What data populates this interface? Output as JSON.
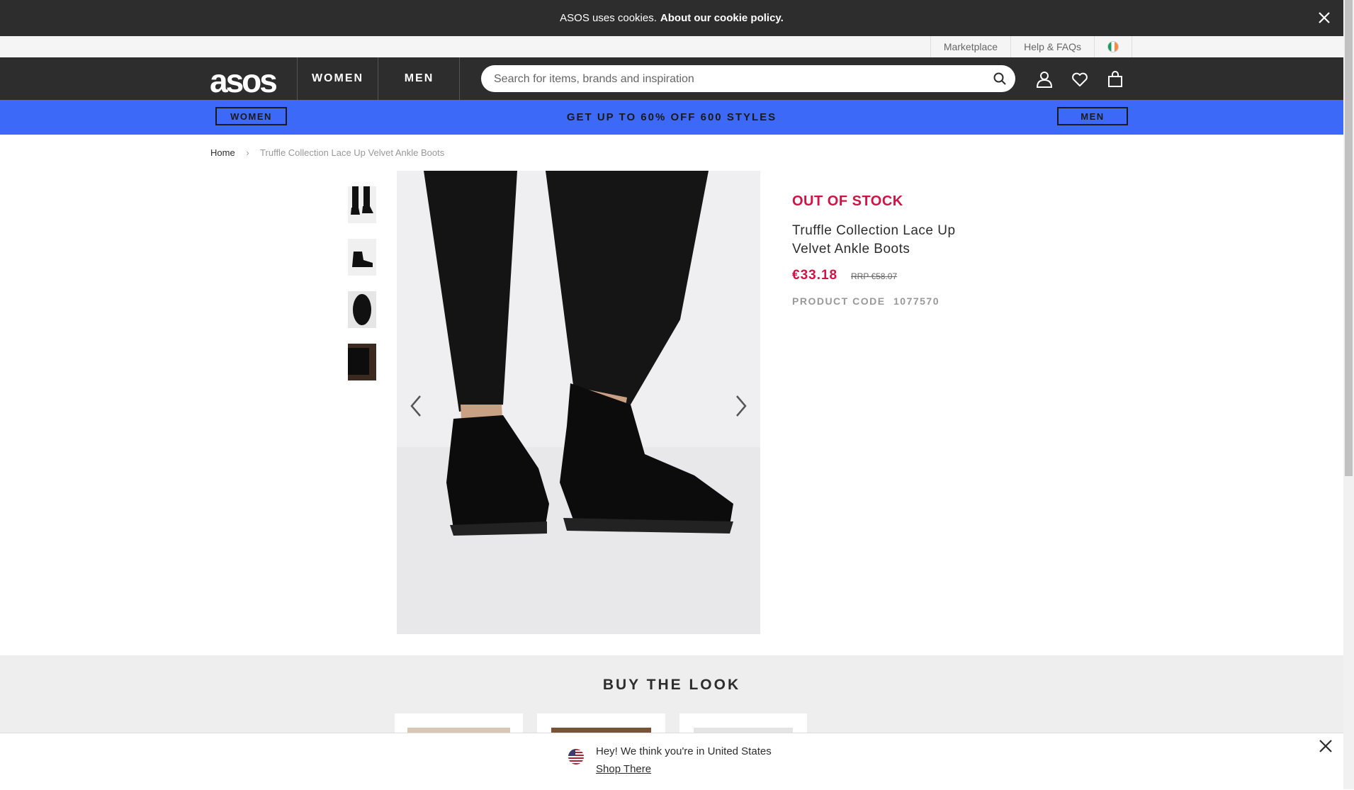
{
  "cookie_bar": {
    "text": "ASOS uses cookies.",
    "link": "About our cookie policy."
  },
  "util": {
    "marketplace": "Marketplace",
    "help": "Help & FAQs"
  },
  "header": {
    "logo": "asos",
    "women": "WOMEN",
    "men": "MEN",
    "search_placeholder": "Search for items, brands and inspiration"
  },
  "promo": {
    "women_button": "WOMEN",
    "men_button": "MEN",
    "text": "GET UP TO 60% OFF 600 STYLES",
    "color": "#3c69f8"
  },
  "breadcrumb": {
    "home": "Home",
    "sep": "›",
    "current": "Truffle Collection Lace Up Velvet Ankle Boots"
  },
  "product": {
    "status": "OUT OF STOCK",
    "title": "Truffle Collection Lace Up Velvet Ankle Boots",
    "price": "€33.18",
    "rrp": "RRP €58.07",
    "code_label": "PRODUCT CODE",
    "code": "1077570",
    "status_color": "#d01345"
  },
  "buy_the_look": {
    "title": "BUY THE LOOK"
  },
  "country_banner": {
    "message": "Hey! We think you're in United States",
    "link": "Shop There"
  }
}
